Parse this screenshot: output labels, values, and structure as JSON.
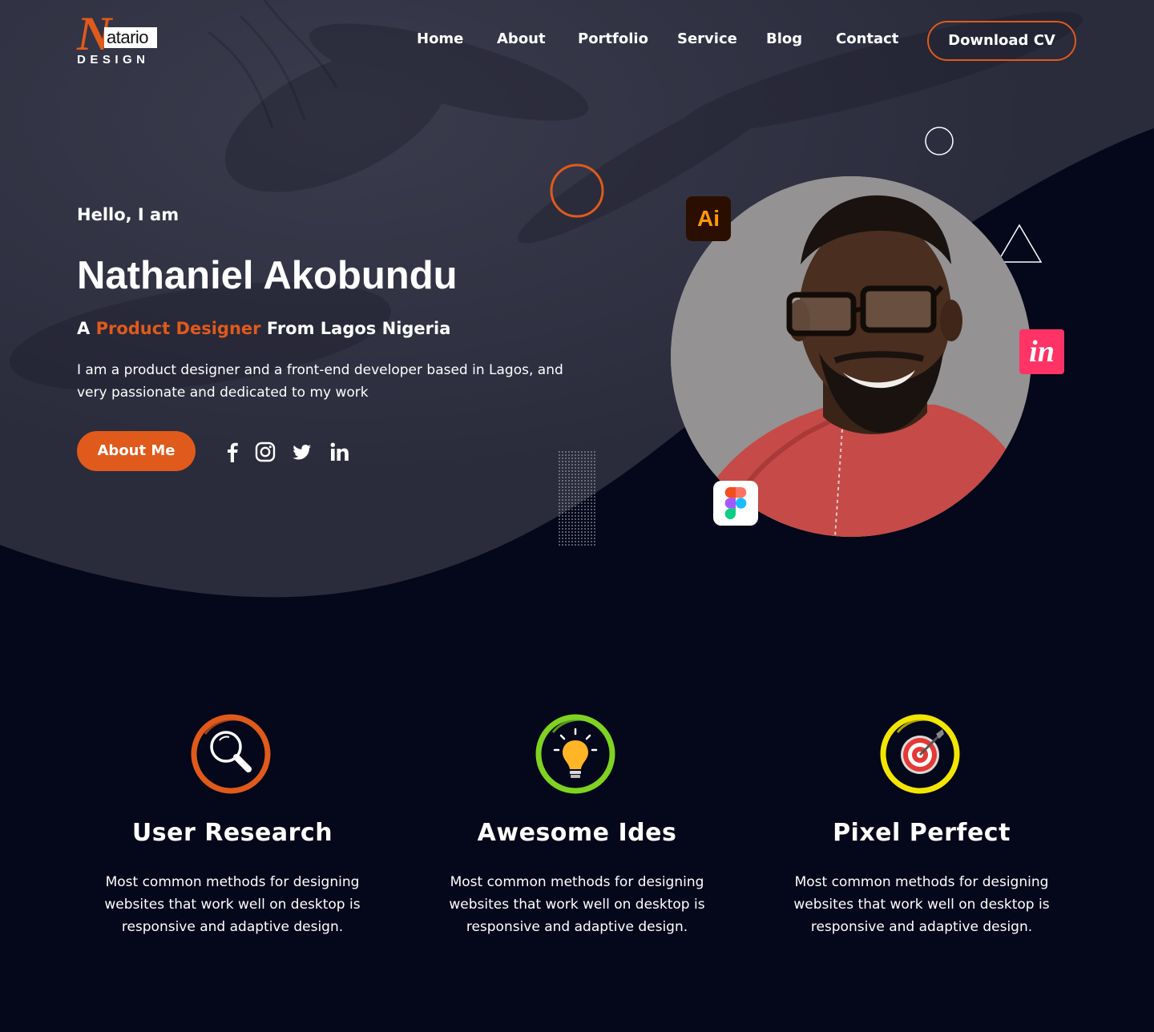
{
  "brand": {
    "logo_n": "N",
    "logo_atario": "atario",
    "logo_design": "DESIGN"
  },
  "nav": {
    "items": [
      "Home",
      "About",
      "Portfolio",
      "Service",
      "Blog",
      "Contact"
    ],
    "cta": "Download CV"
  },
  "hero": {
    "greeting": "Hello, I am",
    "name": "Nathaniel Akobundu",
    "tagline_prefix": "A",
    "tagline_role": "Product Designer",
    "tagline_suffix": "From Lagos Nigeria",
    "intro": "I am a product designer and a front-end developer based in Lagos, and very passionate and dedicated to my work",
    "button": "About Me",
    "social": [
      "facebook-icon",
      "instagram-icon",
      "twitter-icon",
      "linkedin-icon"
    ],
    "tool_badges": {
      "illustrator": "Ai",
      "invision": "in",
      "figma": "figma-icon"
    }
  },
  "features": [
    {
      "icon": "magnifier-icon",
      "title": "User Research",
      "text": "Most common methods for designing websites that work well on desktop is responsive and adaptive design."
    },
    {
      "icon": "lightbulb-icon",
      "title": "Awesome Ides",
      "text": "Most common methods for designing websites that work well on desktop is responsive and adaptive design."
    },
    {
      "icon": "target-icon",
      "title": "Pixel Perfect",
      "text": "Most common methods for designing websites that work well on desktop is responsive and adaptive design."
    }
  ],
  "colors": {
    "accent": "#e05a1b",
    "background": "#05071a",
    "hero_panel": "#2a2b3b",
    "green_ring": "#7ed321",
    "yellow_ring": "#f2e600"
  }
}
